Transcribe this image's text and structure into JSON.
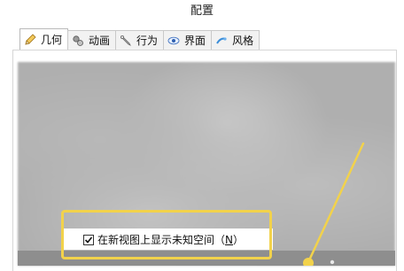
{
  "window": {
    "title": "配置"
  },
  "tabs": [
    {
      "label": "几何",
      "icon": "pencil-icon",
      "active": true
    },
    {
      "label": "动画",
      "icon": "animation-icon",
      "active": false
    },
    {
      "label": "行为",
      "icon": "wrench-icon",
      "active": false
    },
    {
      "label": "界面",
      "icon": "eye-icon",
      "active": false
    },
    {
      "label": "风格",
      "icon": "style-icon",
      "active": false
    }
  ],
  "option": {
    "checked": true,
    "label_before": "在新视图上显示未知空间（",
    "hotkey": "N",
    "label_after": "）"
  },
  "colors": {
    "highlight": "#f2d24b",
    "arrow": "#f2d24b"
  }
}
